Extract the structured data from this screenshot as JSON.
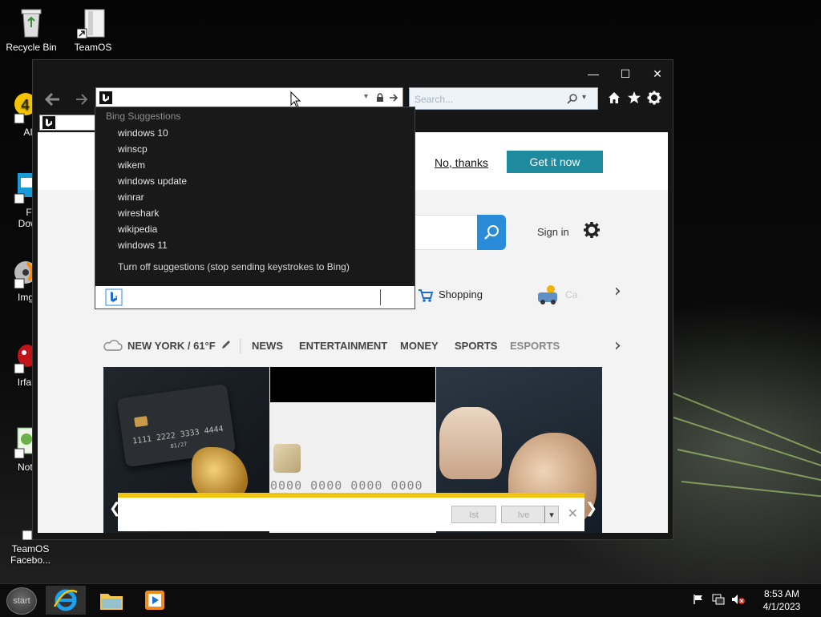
{
  "desktop": {
    "icons": [
      {
        "label": "Recycle Bin",
        "icon": "recycle-bin-icon"
      },
      {
        "label": "TeamOS",
        "icon": "folder-icon"
      },
      {
        "label": "AIM",
        "icon": "aim-icon"
      },
      {
        "label": "Fr\nDown",
        "icon": "download-icon"
      },
      {
        "label": "ImgB",
        "icon": "disc-icon"
      },
      {
        "label": "IrfanVi",
        "icon": "irfanview-icon"
      },
      {
        "label": "Notep",
        "icon": "notepad-icon"
      },
      {
        "label": "TeamOS\nFacebo...",
        "icon": "facebook-shortcut-icon"
      }
    ]
  },
  "window": {
    "controls": {
      "minimize": "—",
      "maximize": "☐",
      "close": "✕"
    },
    "search_placeholder": "Search..."
  },
  "suggestions": {
    "header": "Bing Suggestions",
    "items": [
      "windows 10",
      "winscp",
      "wikem",
      "windows update",
      "winrar",
      "wireshark",
      "wikipedia",
      "windows 11"
    ],
    "turn_off": "Turn off suggestions (stop sending keystrokes to Bing)"
  },
  "page": {
    "no_thanks": "No, thanks",
    "get_it_now": "Get it now",
    "sign_in": "Sign in",
    "shopping": "Shopping",
    "cars_partial": "Ca",
    "weather": "NEW YORK / 61°F",
    "news_tabs": [
      "NEWS",
      "ENTERTAINMENT",
      "MONEY",
      "SPORTS",
      "ESPORTS"
    ],
    "card1_number": "1111 2222 3333 4444",
    "card1_small": "01/27",
    "card2_number": "0000 0000 0000 0000"
  },
  "notification": {
    "button1": "Ist",
    "button2": "Ive"
  },
  "taskbar": {
    "start": "start",
    "time": "8:53 AM",
    "date": "4/1/2023"
  }
}
